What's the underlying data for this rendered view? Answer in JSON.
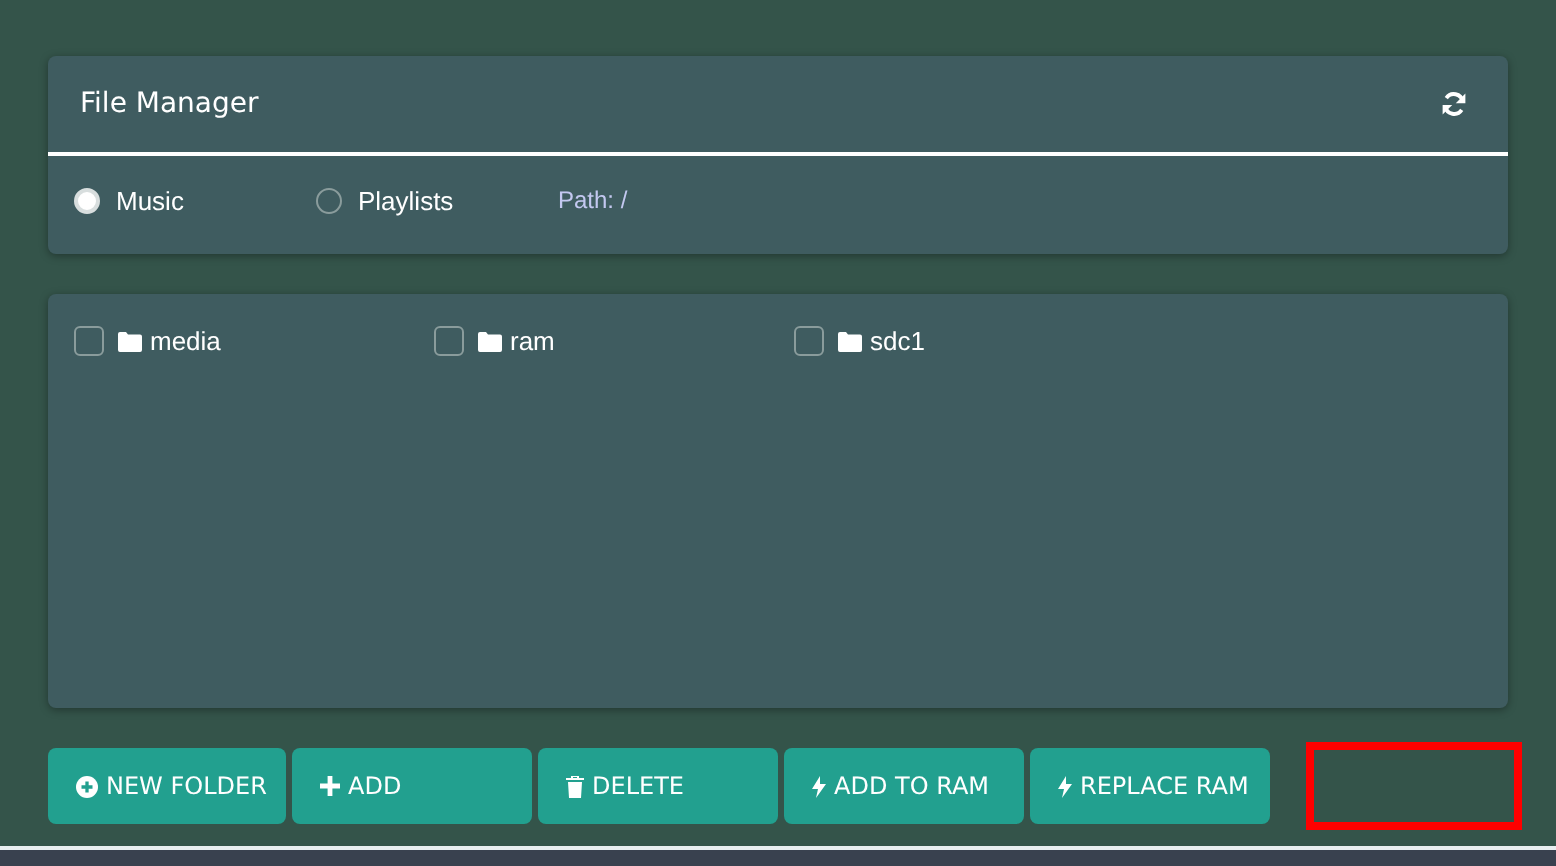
{
  "header": {
    "title": "File Manager"
  },
  "sources": [
    {
      "label": "Music",
      "selected": true
    },
    {
      "label": "Playlists",
      "selected": false
    }
  ],
  "path": "Path: /",
  "files": [
    {
      "name": "media",
      "checked": false
    },
    {
      "name": "ram",
      "checked": false
    },
    {
      "name": "sdc1",
      "checked": false
    }
  ],
  "buttons": [
    {
      "label": "NEW FOLDER",
      "kind": "create"
    },
    {
      "label": "ADD",
      "kind": "add"
    },
    {
      "label": "DELETE",
      "kind": "delete"
    },
    {
      "label": "ADD TO RAM",
      "kind": "ram"
    },
    {
      "label": "REPLACE RAM",
      "kind": "ram"
    }
  ]
}
